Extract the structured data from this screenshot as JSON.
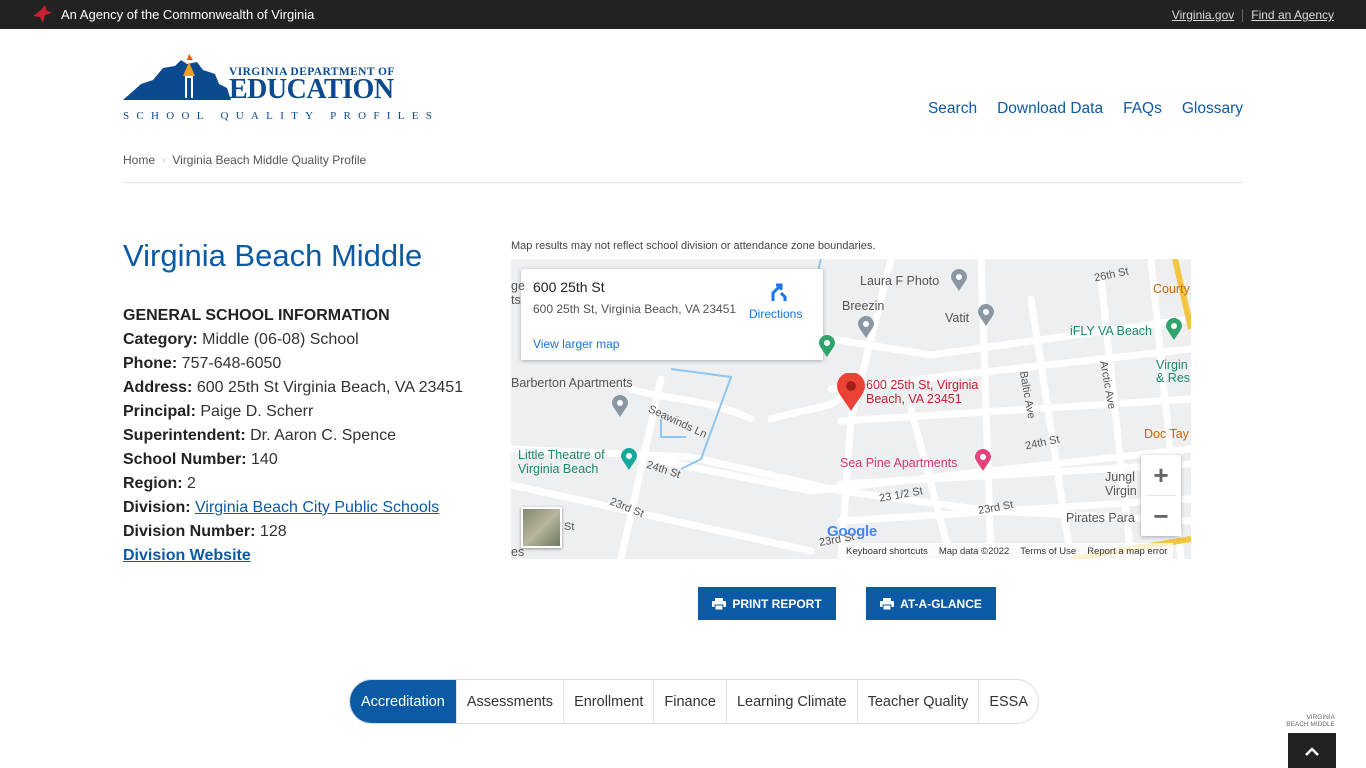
{
  "agency_bar": {
    "text": "An Agency of the Commonwealth of Virginia",
    "links": [
      "Virginia.gov",
      "Find an Agency"
    ]
  },
  "logo": {
    "line1": "VIRGINIA DEPARTMENT OF",
    "line2": "EDUCATION",
    "line3": "SCHOOL QUALITY PROFILES"
  },
  "nav": [
    "Search",
    "Download Data",
    "FAQs",
    "Glossary"
  ],
  "breadcrumb": [
    "Home",
    "Virginia Beach Middle Quality Profile"
  ],
  "school": {
    "name": "Virginia Beach Middle",
    "heading": "GENERAL SCHOOL INFORMATION",
    "fields": [
      {
        "label": "Category:",
        "value": "Middle (06-08) School"
      },
      {
        "label": "Phone:",
        "value": "757-648-6050"
      },
      {
        "label": "Address:",
        "value": "600 25th St Virginia Beach, VA 23451"
      },
      {
        "label": "Principal:",
        "value": "Paige D. Scherr"
      },
      {
        "label": "Superintendent:",
        "value": "Dr. Aaron C. Spence"
      },
      {
        "label": "School Number:",
        "value": "140"
      },
      {
        "label": "Region:",
        "value": "2"
      }
    ],
    "division_label": "Division:",
    "division_value": "Virginia Beach City Public Schools",
    "division_number_label": "Division Number:",
    "division_number_value": "128",
    "division_website": "Division Website"
  },
  "map": {
    "note": "Map results may not reflect school division or attendance zone boundaries.",
    "card_title": "600 25th St",
    "card_address": "600 25th St, Virginia Beach, VA 23451",
    "card_link": "View larger map",
    "directions": "Directions",
    "marker_label_1": "600 25th St, Virginia",
    "marker_label_2": "Beach, VA 23451",
    "places": {
      "laura": "Laura F Photo",
      "breezin": "Breezin",
      "vatit": "Vatit",
      "ifly": "iFLY VA Beach",
      "barberton": "Barberton Apartments",
      "theatre_1": "Little Theatre of",
      "theatre_2": "Virginia Beach",
      "sea_pine": "Sea Pine Apartments",
      "courty": "Courty",
      "virgin_1": "Virgin",
      "virgin_2": "& Res",
      "doc": "Doc Tay",
      "jungle_1": "Jungl",
      "jungle_2": "Virgin",
      "pirates": "Pirates Para",
      "ges": "ge",
      "ts": "ts",
      "es": "es"
    },
    "streets": {
      "s26": "26th St",
      "s24a": "24th St",
      "s24b": "24th St",
      "s23half": "23 1/2 St",
      "s23a": "23rd St",
      "s23b": "23rd St",
      "s23c": "23rd St",
      "baltic": "Baltic Ave",
      "arctic": "Arctic Ave",
      "seawinds": "Seawinds Ln",
      "st_frag": "St"
    },
    "google": "Google",
    "attribution": [
      "Keyboard shortcuts",
      "Map data ©2022",
      "Terms of Use",
      "Report a map error"
    ],
    "zoom_in": "+",
    "zoom_out": "−"
  },
  "buttons": {
    "print": "PRINT REPORT",
    "glance": "AT-A-GLANCE"
  },
  "tabs": [
    "Accreditation",
    "Assessments",
    "Enrollment",
    "Finance",
    "Learning Climate",
    "Teacher Quality",
    "ESSA"
  ],
  "corner_badge": [
    "VIRGINIA",
    "BEACH MIDDLE"
  ],
  "colors": {
    "brand_blue": "#0b5aa6",
    "agency_bar": "#222222"
  }
}
